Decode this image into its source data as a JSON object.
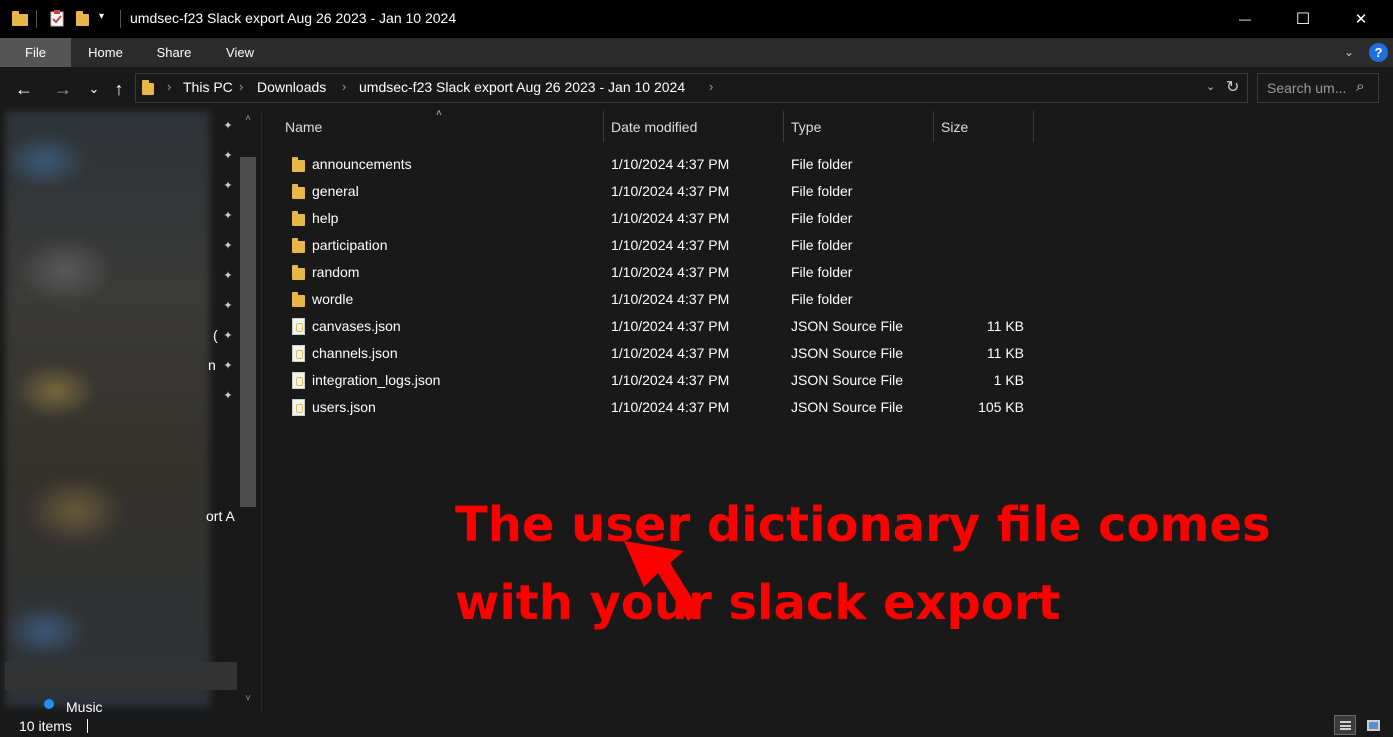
{
  "window": {
    "title": "umdsec-f23 Slack export Aug 26 2023 - Jan 10 2024",
    "quick_access_dropdown": "▾",
    "minimize": "—",
    "maximize": "☐",
    "close": "✕"
  },
  "ribbon": {
    "tabs": [
      "File",
      "Home",
      "Share",
      "View"
    ],
    "expand": "⌄",
    "help": "?"
  },
  "nav_buttons": {
    "back": "←",
    "forward": "→",
    "recent": "⌄",
    "up": "↑"
  },
  "address": {
    "breadcrumbs": [
      "This PC",
      "Downloads",
      "umdsec-f23 Slack export Aug 26 2023 - Jan 10 2024"
    ],
    "separator": "›",
    "dropdown": "⌄",
    "refresh": "↻"
  },
  "search": {
    "placeholder": "Search um...",
    "icon": "⌕"
  },
  "navpane": {
    "pin_glyph": "📌",
    "fragments": [
      "(",
      "n",
      "ort A"
    ],
    "scroll_up": "˄",
    "scroll_down": "˅",
    "music_label": "Music"
  },
  "columns": {
    "name": "Name",
    "date": "Date modified",
    "type": "Type",
    "size": "Size",
    "sort_glyph": "˄"
  },
  "files": [
    {
      "name": "announcements",
      "date": "1/10/2024 4:37 PM",
      "type": "File folder",
      "size": "",
      "kind": "folder"
    },
    {
      "name": "general",
      "date": "1/10/2024 4:37 PM",
      "type": "File folder",
      "size": "",
      "kind": "folder"
    },
    {
      "name": "help",
      "date": "1/10/2024 4:37 PM",
      "type": "File folder",
      "size": "",
      "kind": "folder"
    },
    {
      "name": "participation",
      "date": "1/10/2024 4:37 PM",
      "type": "File folder",
      "size": "",
      "kind": "folder"
    },
    {
      "name": "random",
      "date": "1/10/2024 4:37 PM",
      "type": "File folder",
      "size": "",
      "kind": "folder"
    },
    {
      "name": "wordle",
      "date": "1/10/2024 4:37 PM",
      "type": "File folder",
      "size": "",
      "kind": "folder"
    },
    {
      "name": "canvases.json",
      "date": "1/10/2024 4:37 PM",
      "type": "JSON Source File",
      "size": "11 KB",
      "kind": "json"
    },
    {
      "name": "channels.json",
      "date": "1/10/2024 4:37 PM",
      "type": "JSON Source File",
      "size": "11 KB",
      "kind": "json"
    },
    {
      "name": "integration_logs.json",
      "date": "1/10/2024 4:37 PM",
      "type": "JSON Source File",
      "size": "1 KB",
      "kind": "json"
    },
    {
      "name": "users.json",
      "date": "1/10/2024 4:37 PM",
      "type": "JSON Source File",
      "size": "105 KB",
      "kind": "json"
    }
  ],
  "annotation": {
    "line1": "The user dictionary file comes",
    "line2": "with your slack export",
    "color": "#ff0000"
  },
  "status": {
    "item_count": "10 items"
  },
  "colors": {
    "background": "#191919",
    "titlebar": "#000000",
    "ribbon": "#2b2b2b",
    "file_tab": "#555555",
    "folder": "#e8b74a",
    "accent_blue": "#1e6fd9"
  }
}
